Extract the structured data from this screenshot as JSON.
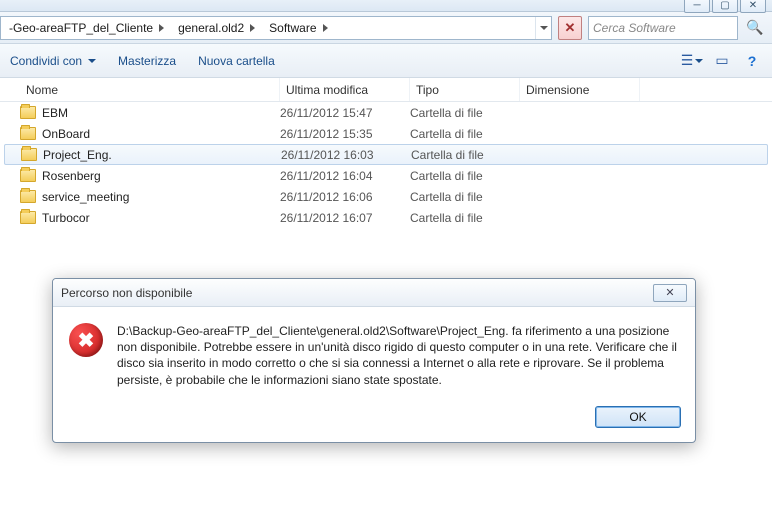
{
  "window": {
    "breadcrumb": [
      "-Geo-areaFTP_del_Cliente",
      "general.old2",
      "Software"
    ],
    "search_placeholder": "Cerca Software"
  },
  "toolbar": {
    "share_label": "Condividi con",
    "burn_label": "Masterizza",
    "newfolder_label": "Nuova cartella"
  },
  "columns": {
    "name": "Nome",
    "modified": "Ultima modifica",
    "type": "Tipo",
    "size": "Dimensione"
  },
  "folder_type": "Cartella di file",
  "files": [
    {
      "name": "EBM",
      "modified": "26/11/2012 15:47",
      "selected": false
    },
    {
      "name": "OnBoard",
      "modified": "26/11/2012 15:35",
      "selected": false
    },
    {
      "name": "Project_Eng.",
      "modified": "26/11/2012 16:03",
      "selected": true
    },
    {
      "name": "Rosenberg",
      "modified": "26/11/2012 16:04",
      "selected": false
    },
    {
      "name": "service_meeting",
      "modified": "26/11/2012 16:06",
      "selected": false
    },
    {
      "name": "Turbocor",
      "modified": "26/11/2012 16:07",
      "selected": false
    }
  ],
  "dialog": {
    "title": "Percorso non disponibile",
    "message": "D:\\Backup-Geo-areaFTP_del_Cliente\\general.old2\\Software\\Project_Eng. fa riferimento a una posizione non disponibile. Potrebbe essere in un'unità disco rigido di questo computer o in una rete. Verificare che il disco sia inserito in modo corretto o che si sia connessi a Internet o alla rete e riprovare. Se il problema persiste, è probabile che le informazioni siano state spostate.",
    "ok_label": "OK",
    "close_glyph": "✕"
  }
}
